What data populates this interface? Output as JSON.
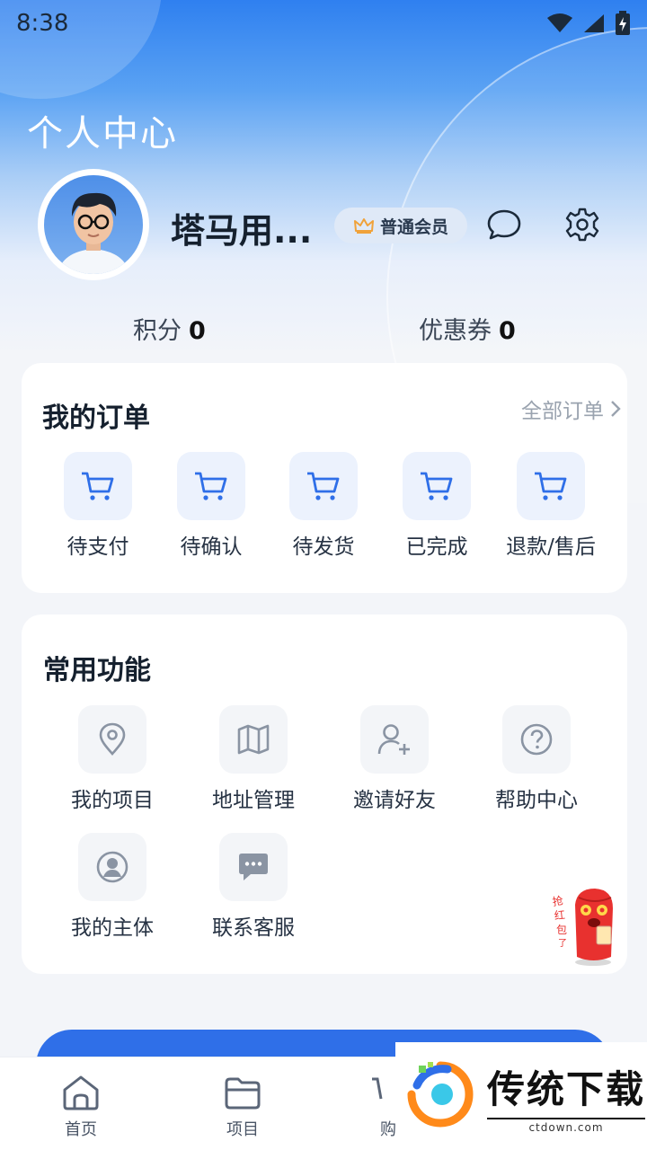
{
  "status_bar": {
    "time": "8:38"
  },
  "header": {
    "title": "个人中心"
  },
  "profile": {
    "username": "塔马用...",
    "member_badge": "普通会员",
    "points_label": "积分",
    "points_value": "0",
    "coupons_label": "优惠券",
    "coupons_value": "0"
  },
  "orders": {
    "title": "我的订单",
    "all_link": "全部订单",
    "items": [
      {
        "label": "待支付",
        "icon": "cart-icon"
      },
      {
        "label": "待确认",
        "icon": "cart-icon"
      },
      {
        "label": "待发货",
        "icon": "cart-icon"
      },
      {
        "label": "已完成",
        "icon": "cart-icon"
      },
      {
        "label": "退款/售后",
        "icon": "cart-icon"
      }
    ]
  },
  "functions": {
    "title": "常用功能",
    "items": [
      {
        "label": "我的项目",
        "icon": "location-pin-icon"
      },
      {
        "label": "地址管理",
        "icon": "map-icon"
      },
      {
        "label": "邀请好友",
        "icon": "add-user-icon"
      },
      {
        "label": "帮助中心",
        "icon": "help-icon"
      },
      {
        "label": "我的主体",
        "icon": "user-circle-icon"
      },
      {
        "label": "联系客服",
        "icon": "chat-bubble-icon"
      }
    ]
  },
  "mascot": {
    "text": "抢红包了"
  },
  "tabbar": {
    "items": [
      {
        "label": "首页",
        "icon": "home-icon"
      },
      {
        "label": "项目",
        "icon": "folder-icon"
      },
      {
        "label": "购",
        "icon": "cart-icon"
      }
    ]
  },
  "watermark": {
    "brand": "传统下载",
    "domain": "ctdown.com"
  },
  "colors": {
    "primary": "#2f6fe8",
    "accent_gold": "#f0a23a",
    "icon_blue": "#2f6fe8",
    "icon_gray": "#8a94a3"
  }
}
